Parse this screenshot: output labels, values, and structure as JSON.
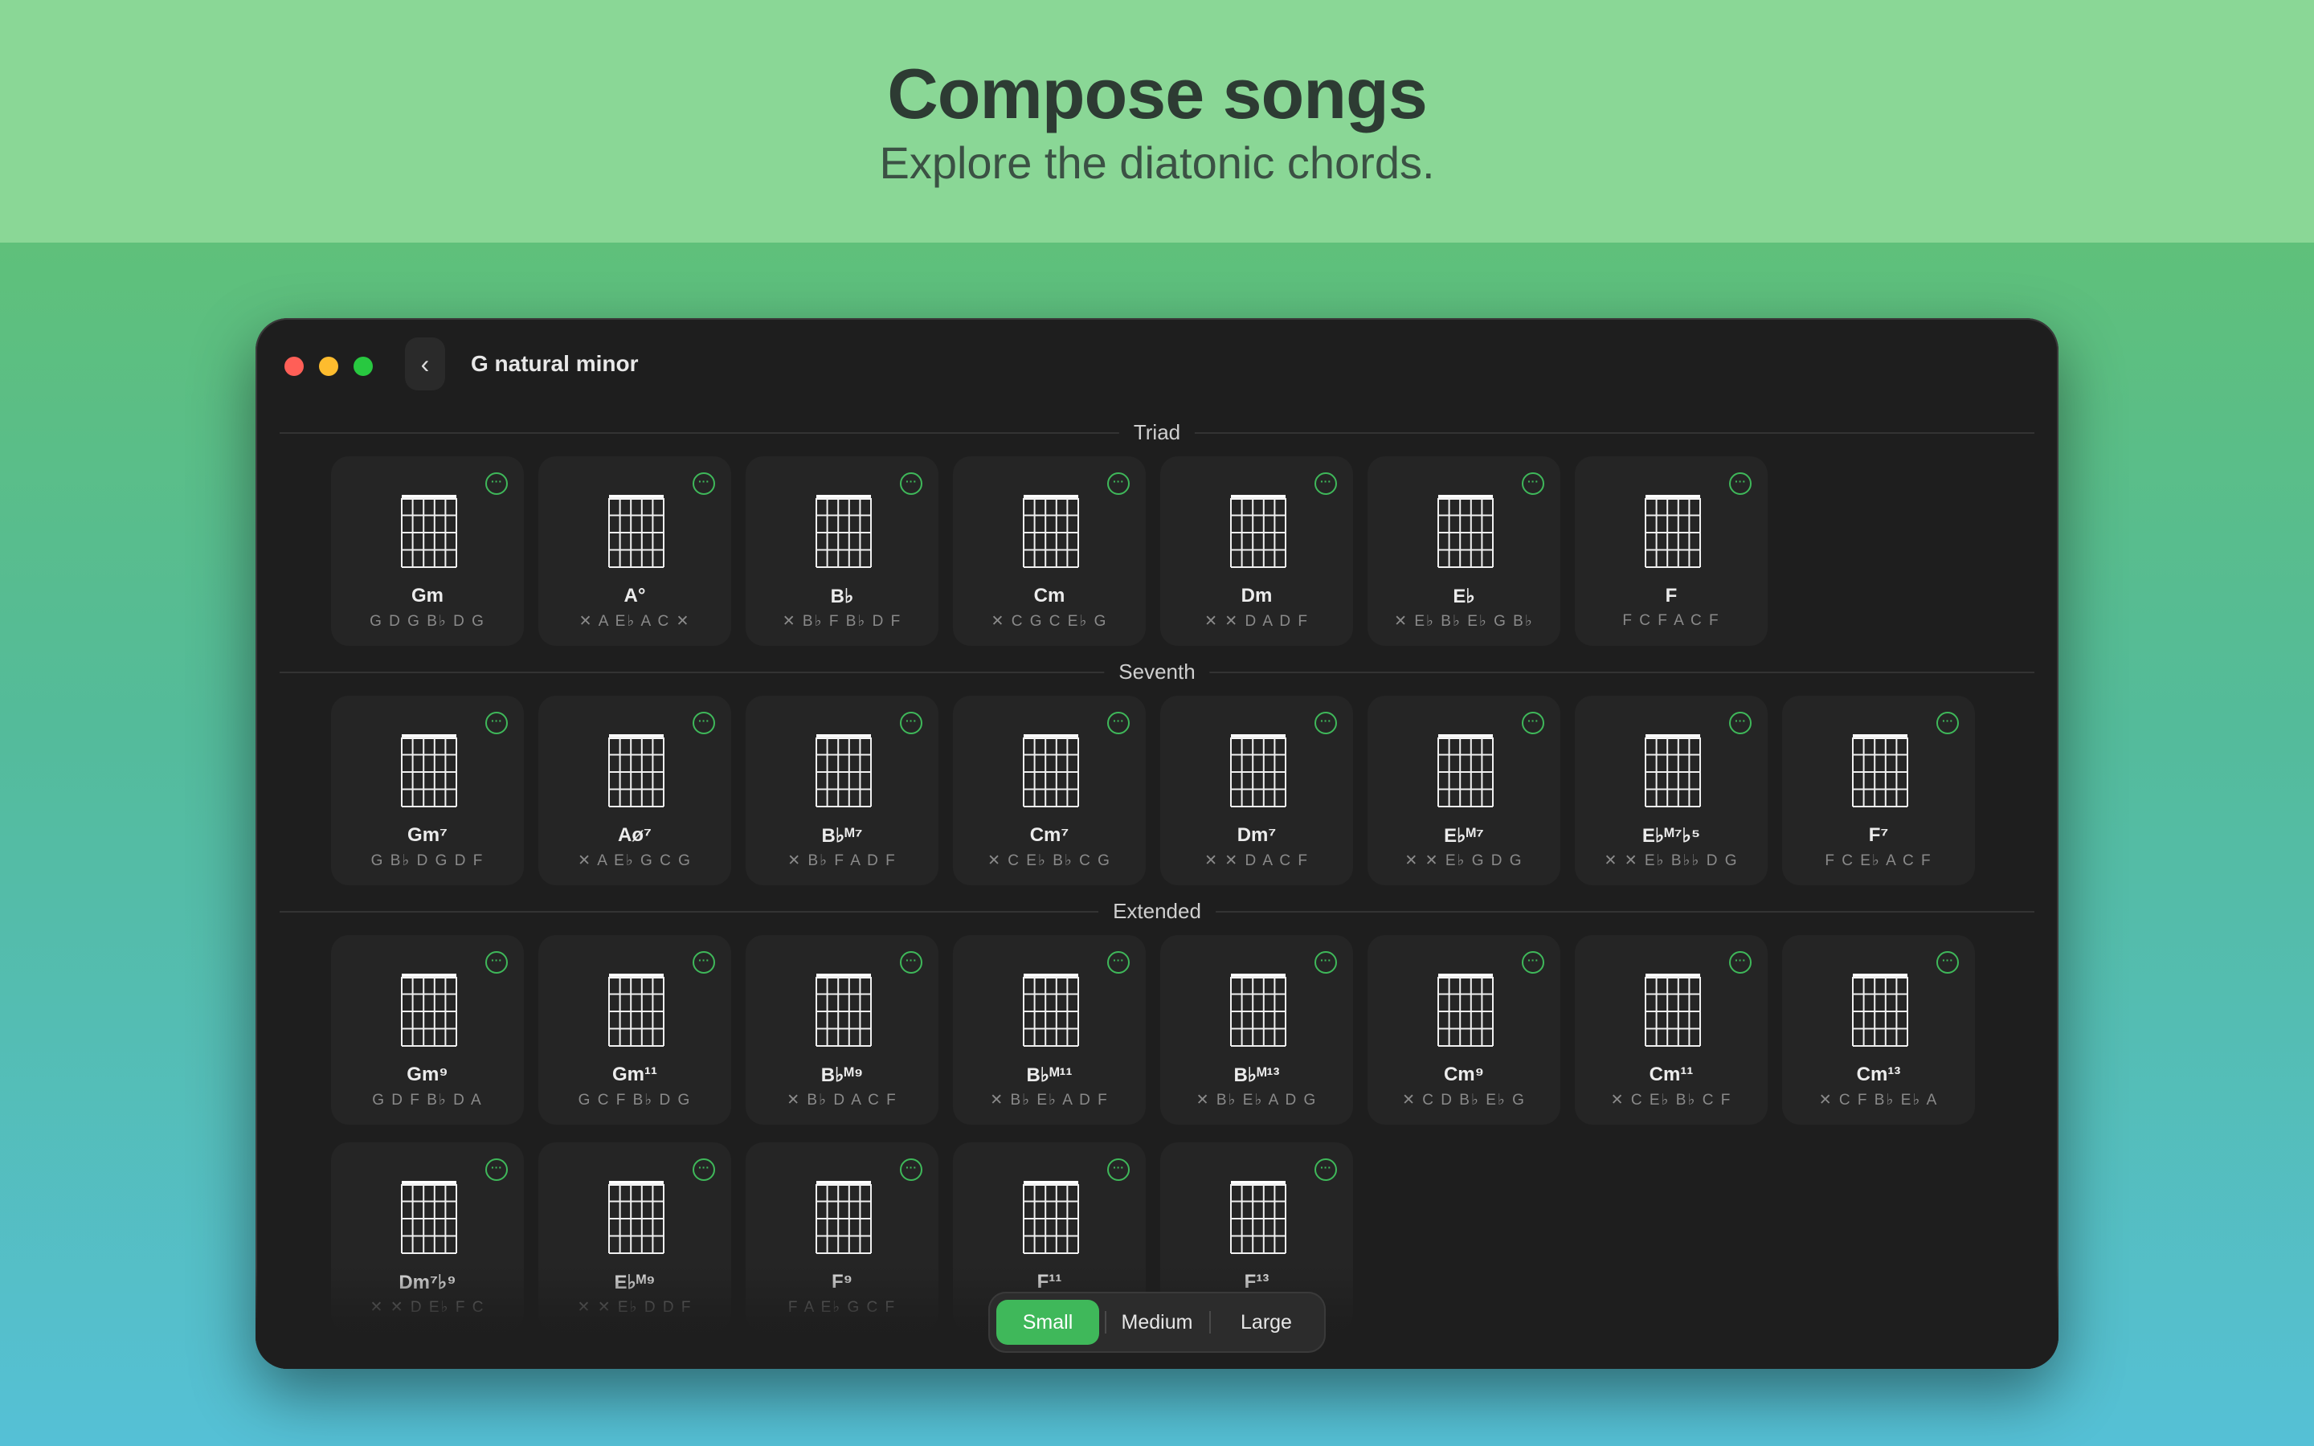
{
  "hero": {
    "title": "Compose songs",
    "subtitle": "Explore the diatonic chords."
  },
  "window": {
    "title": "G natural minor",
    "back_icon": "chevron-left-icon"
  },
  "colors": {
    "accent": "#3fb85a",
    "window_bg": "#1e1e1e",
    "card_bg": "#252525",
    "close": "#ff5f57",
    "minimize": "#febc2e",
    "zoom": "#28c840"
  },
  "sections": [
    {
      "label": "Triad",
      "chords": [
        {
          "name": "Gm",
          "notes": "G D G B♭ D G"
        },
        {
          "name": "A°",
          "notes": "✕ A E♭ A C ✕"
        },
        {
          "name": "B♭",
          "notes": "✕ B♭ F B♭ D F"
        },
        {
          "name": "Cm",
          "notes": "✕ C G C E♭ G"
        },
        {
          "name": "Dm",
          "notes": "✕ ✕ D A D F"
        },
        {
          "name": "E♭",
          "notes": "✕ E♭ B♭ E♭ G B♭"
        },
        {
          "name": "F",
          "notes": "F C F A C F"
        }
      ]
    },
    {
      "label": "Seventh",
      "chords": [
        {
          "name": "Gm⁷",
          "notes": "G B♭ D G D F"
        },
        {
          "name": "Aø⁷",
          "notes": "✕ A E♭ G C G"
        },
        {
          "name": "B♭ᴹ⁷",
          "notes": "✕ B♭ F A D F"
        },
        {
          "name": "Cm⁷",
          "notes": "✕ C E♭ B♭ C G"
        },
        {
          "name": "Dm⁷",
          "notes": "✕ ✕ D A C F"
        },
        {
          "name": "E♭ᴹ⁷",
          "notes": "✕ ✕ E♭ G D G"
        },
        {
          "name": "E♭ᴹ⁷♭⁵",
          "notes": "✕ ✕ E♭ B♭♭ D G"
        },
        {
          "name": "F⁷",
          "notes": "F C E♭ A C F"
        }
      ]
    },
    {
      "label": "Extended",
      "chords": [
        {
          "name": "Gm⁹",
          "notes": "G D F B♭ D A"
        },
        {
          "name": "Gm¹¹",
          "notes": "G C F B♭ D G"
        },
        {
          "name": "B♭ᴹ⁹",
          "notes": "✕ B♭ D A C F"
        },
        {
          "name": "B♭ᴹ¹¹",
          "notes": "✕ B♭ E♭ A D F"
        },
        {
          "name": "B♭ᴹ¹³",
          "notes": "✕ B♭ E♭ A D G"
        },
        {
          "name": "Cm⁹",
          "notes": "✕ C D B♭ E♭ G"
        },
        {
          "name": "Cm¹¹",
          "notes": "✕ C E♭ B♭ C F"
        },
        {
          "name": "Cm¹³",
          "notes": "✕ C F B♭ E♭ A"
        },
        {
          "name": "Dm⁷♭⁹",
          "notes": "✕ ✕ D E♭ F C"
        },
        {
          "name": "E♭ᴹ⁹",
          "notes": "✕ ✕ E♭ D D F"
        },
        {
          "name": "F⁹",
          "notes": "F A E♭ G C F"
        },
        {
          "name": "F¹¹",
          "notes": ""
        },
        {
          "name": "F¹³",
          "notes": ""
        }
      ]
    }
  ],
  "size_control": {
    "options": [
      "Small",
      "Medium",
      "Large"
    ],
    "selected": "Small"
  }
}
